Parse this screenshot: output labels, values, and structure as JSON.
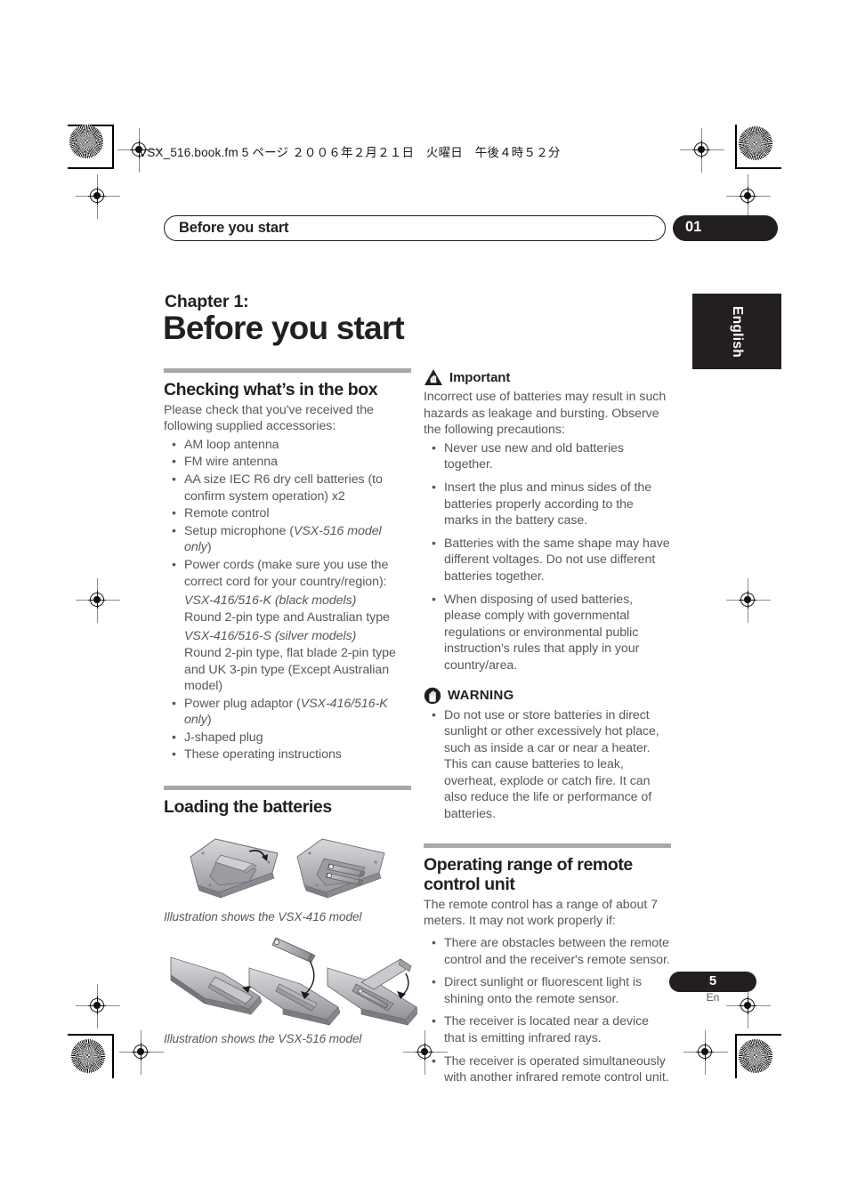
{
  "print_marks": {
    "slug_line": "VSX_516.book.fm  5 ページ  ２００６年２月２１日　火曜日　午後４時５２分"
  },
  "running_header": {
    "title": "Before you start",
    "chapter_number": "01"
  },
  "language_tab": {
    "label": "English"
  },
  "chapter": {
    "label": "Chapter 1:",
    "title": "Before you start"
  },
  "left_column": {
    "section_checking": {
      "heading": "Checking what’s in the box",
      "intro": "Please check that you've received the following supplied accessories:",
      "items": [
        "AM loop antenna",
        "FM wire antenna",
        "AA size IEC R6 dry cell batteries (to confirm system operation) x2",
        "Remote control"
      ],
      "item_setup_mic": {
        "text": "Setup microphone (",
        "italic": "VSX-516 model only",
        "tail": ")"
      },
      "item_power_cords": "Power cords (make sure you use the correct cord for your country/region):",
      "power_cord_variants": [
        {
          "model": "VSX-416/516-K (black models)",
          "description": "Round 2-pin type and Australian type"
        },
        {
          "model": "VSX-416/516-S (silver models)",
          "description": "Round 2-pin type, flat blade 2-pin type and UK 3-pin type (Except Australian model)"
        }
      ],
      "item_plug_adaptor": {
        "text": "Power plug adaptor (",
        "italic": "VSX-416/516-K only",
        "tail": ")"
      },
      "items_tail": [
        "J-shaped plug",
        "These operating instructions"
      ]
    },
    "section_batteries": {
      "heading": "Loading the batteries",
      "figure_1_caption": "Illustration shows the VSX-416 model",
      "figure_2_caption": "Illustration shows the VSX-516 model"
    }
  },
  "right_column": {
    "important": {
      "icon": "warning-triangle-hand-icon",
      "label": "Important",
      "intro": "Incorrect use of batteries may result in such hazards as leakage and bursting. Observe the following precautions:",
      "items": [
        "Never use new and old batteries together.",
        "Insert the plus and minus sides of the batteries properly according to the marks in the battery case.",
        "Batteries with the same shape may have different voltages. Do not use different batteries together.",
        "When disposing of used batteries, please comply with governmental regulations or environmental public instruction's rules that apply in your country/area."
      ]
    },
    "warning": {
      "icon": "warning-circle-hand-icon",
      "label": "WARNING",
      "items": [
        "Do not use or store batteries in direct sunlight or other excessively hot place, such as inside a car or near a heater. This can cause batteries to leak, overheat, explode or catch fire. It can also reduce the life or performance of batteries."
      ]
    },
    "operating_range": {
      "heading": "Operating range of remote control unit",
      "intro": "The remote control has a range of about 7 meters. It may not work properly if:",
      "items": [
        "There are obstacles between the remote control and the receiver's remote sensor.",
        "Direct sunlight or fluorescent light is shining onto the remote sensor.",
        "The receiver is located near a device that is emitting infrared rays.",
        "The receiver is operated simultaneously with another infrared remote control unit."
      ]
    }
  },
  "footer": {
    "page_number": "5",
    "page_language": "En"
  },
  "colors": {
    "ink_black": "#231f20",
    "body_gray": "#58585a",
    "rule_gray": "#a7a9ac"
  }
}
